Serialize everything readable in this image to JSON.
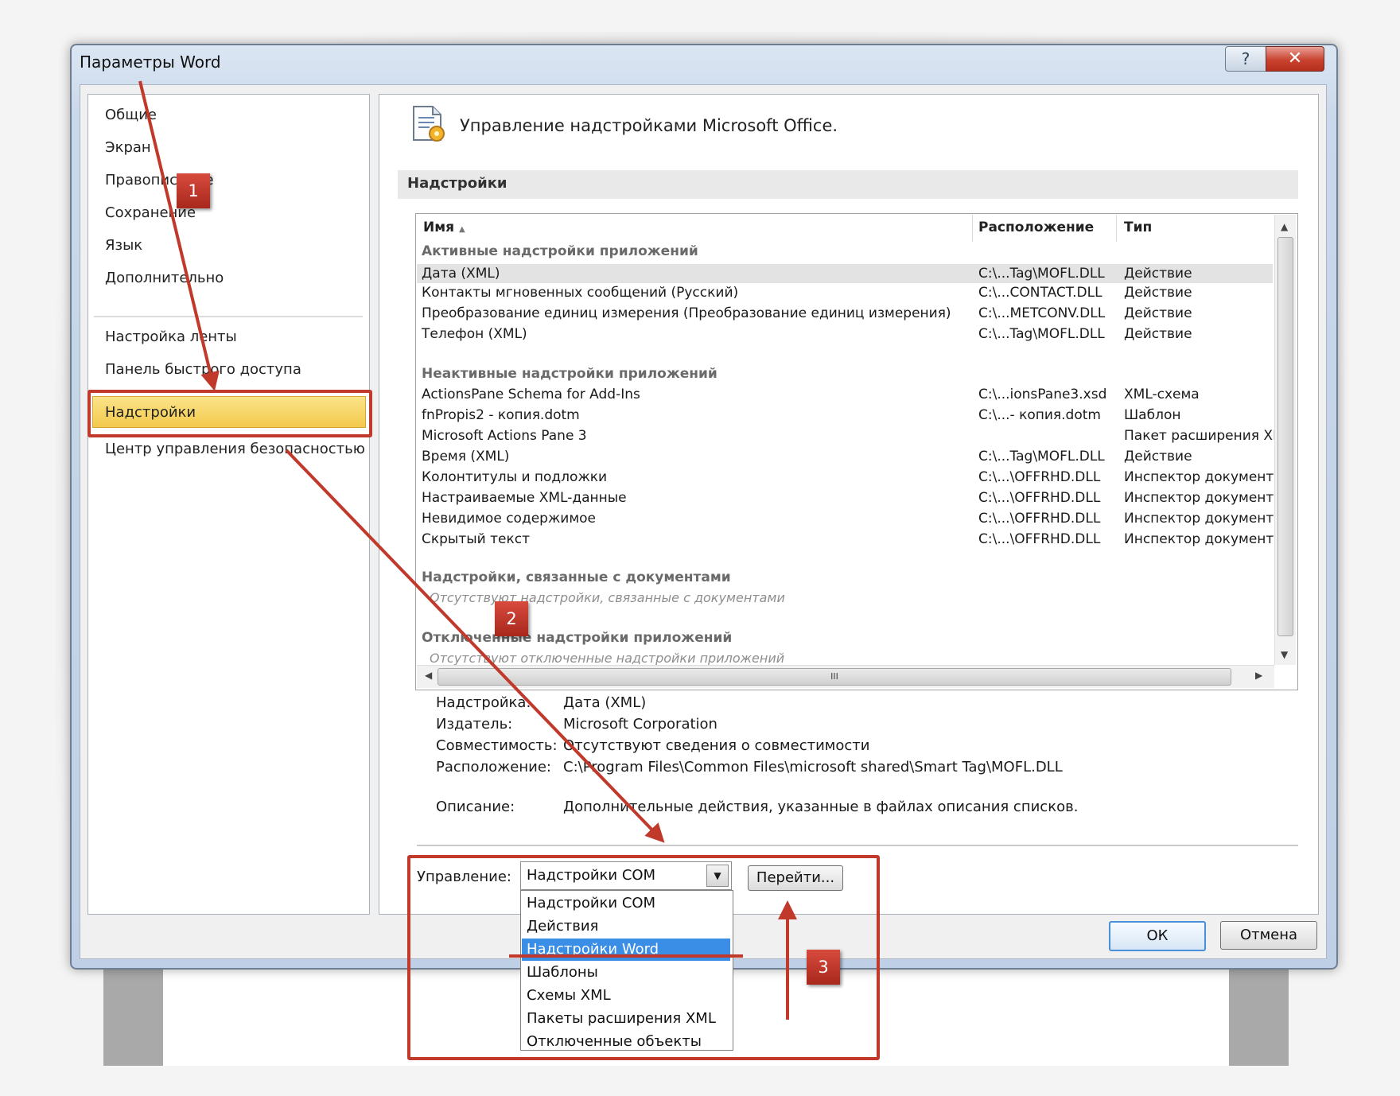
{
  "window": {
    "title": "Параметры Word",
    "help": "?",
    "close": "✕"
  },
  "nav": {
    "items": [
      "Общие",
      "Экран",
      "Правописание",
      "Сохранение",
      "Язык",
      "Дополнительно",
      "Настройка ленты",
      "Панель быстрого доступа",
      "Надстройки",
      "Центр управления безопасностью"
    ],
    "selected": "Надстройки"
  },
  "header": {
    "text": "Управление надстройками Microsoft Office."
  },
  "section": {
    "title": "Надстройки"
  },
  "table": {
    "columns": {
      "name": "Имя",
      "location": "Расположение",
      "type": "Тип"
    },
    "active": {
      "title": "Активные надстройки приложений",
      "rows": [
        {
          "name": "Дата (XML)",
          "location": "C:\\...Tag\\MOFL.DLL",
          "type": "Действие"
        },
        {
          "name": "Контакты мгновенных сообщений (Русский)",
          "location": "C:\\...CONTACT.DLL",
          "type": "Действие"
        },
        {
          "name": "Преобразование единиц измерения (Преобразование единиц измерения)",
          "location": "C:\\...METCONV.DLL",
          "type": "Действие"
        },
        {
          "name": "Телефон (XML)",
          "location": "C:\\...Tag\\MOFL.DLL",
          "type": "Действие"
        }
      ]
    },
    "inactive": {
      "title": "Неактивные надстройки приложений",
      "rows": [
        {
          "name": "ActionsPane Schema for Add-Ins",
          "location": "C:\\...ionsPane3.xsd",
          "type": "XML-схема"
        },
        {
          "name": "fnPropis2 - копия.dotm",
          "location": "C:\\...- копия.dotm",
          "type": "Шаблон"
        },
        {
          "name": "Microsoft Actions Pane 3",
          "location": "",
          "type": "Пакет расширения XI"
        },
        {
          "name": "Время (XML)",
          "location": "C:\\...Tag\\MOFL.DLL",
          "type": "Действие"
        },
        {
          "name": "Колонтитулы и подложки",
          "location": "C:\\...\\OFFRHD.DLL",
          "type": "Инспектор документ"
        },
        {
          "name": "Настраиваемые XML-данные",
          "location": "C:\\...\\OFFRHD.DLL",
          "type": "Инспектор документ"
        },
        {
          "name": "Невидимое содержимое",
          "location": "C:\\...\\OFFRHD.DLL",
          "type": "Инспектор документ"
        },
        {
          "name": "Скрытый текст",
          "location": "C:\\...\\OFFRHD.DLL",
          "type": "Инспектор документ"
        }
      ]
    },
    "document": {
      "title": "Надстройки, связанные с документами",
      "empty": "Отсутствуют надстройки, связанные с документами"
    },
    "disabled": {
      "title": "Отключенные надстройки приложений",
      "empty": "Отсутствуют отключенные надстройки приложений"
    },
    "hscroll_grip": "III"
  },
  "details": {
    "addin_label": "Надстройка:",
    "addin": "Дата (XML)",
    "publisher_label": "Издатель:",
    "publisher": "Microsoft Corporation",
    "compat_label": "Совместимость:",
    "compat": "Отсутствуют сведения о совместимости",
    "location_label": "Расположение:",
    "location": "C:\\Program Files\\Common Files\\microsoft shared\\Smart Tag\\MOFL.DLL",
    "desc_label": "Описание:",
    "desc": "Дополнительные действия, указанные в файлах описания списков."
  },
  "manage": {
    "label": "Управление:",
    "selected": "Надстройки COM",
    "go": "Перейти...",
    "options": [
      "Надстройки COM",
      "Действия",
      "Надстройки Word",
      "Шаблоны",
      "Схемы XML",
      "Пакеты расширения XML",
      "Отключенные объекты"
    ],
    "highlighted": "Надстройки Word"
  },
  "buttons": {
    "ok": "ОК",
    "cancel": "Отмена"
  },
  "annotations": {
    "badge1": "1",
    "badge2": "2",
    "badge3": "3",
    "color": "#c0392b"
  }
}
